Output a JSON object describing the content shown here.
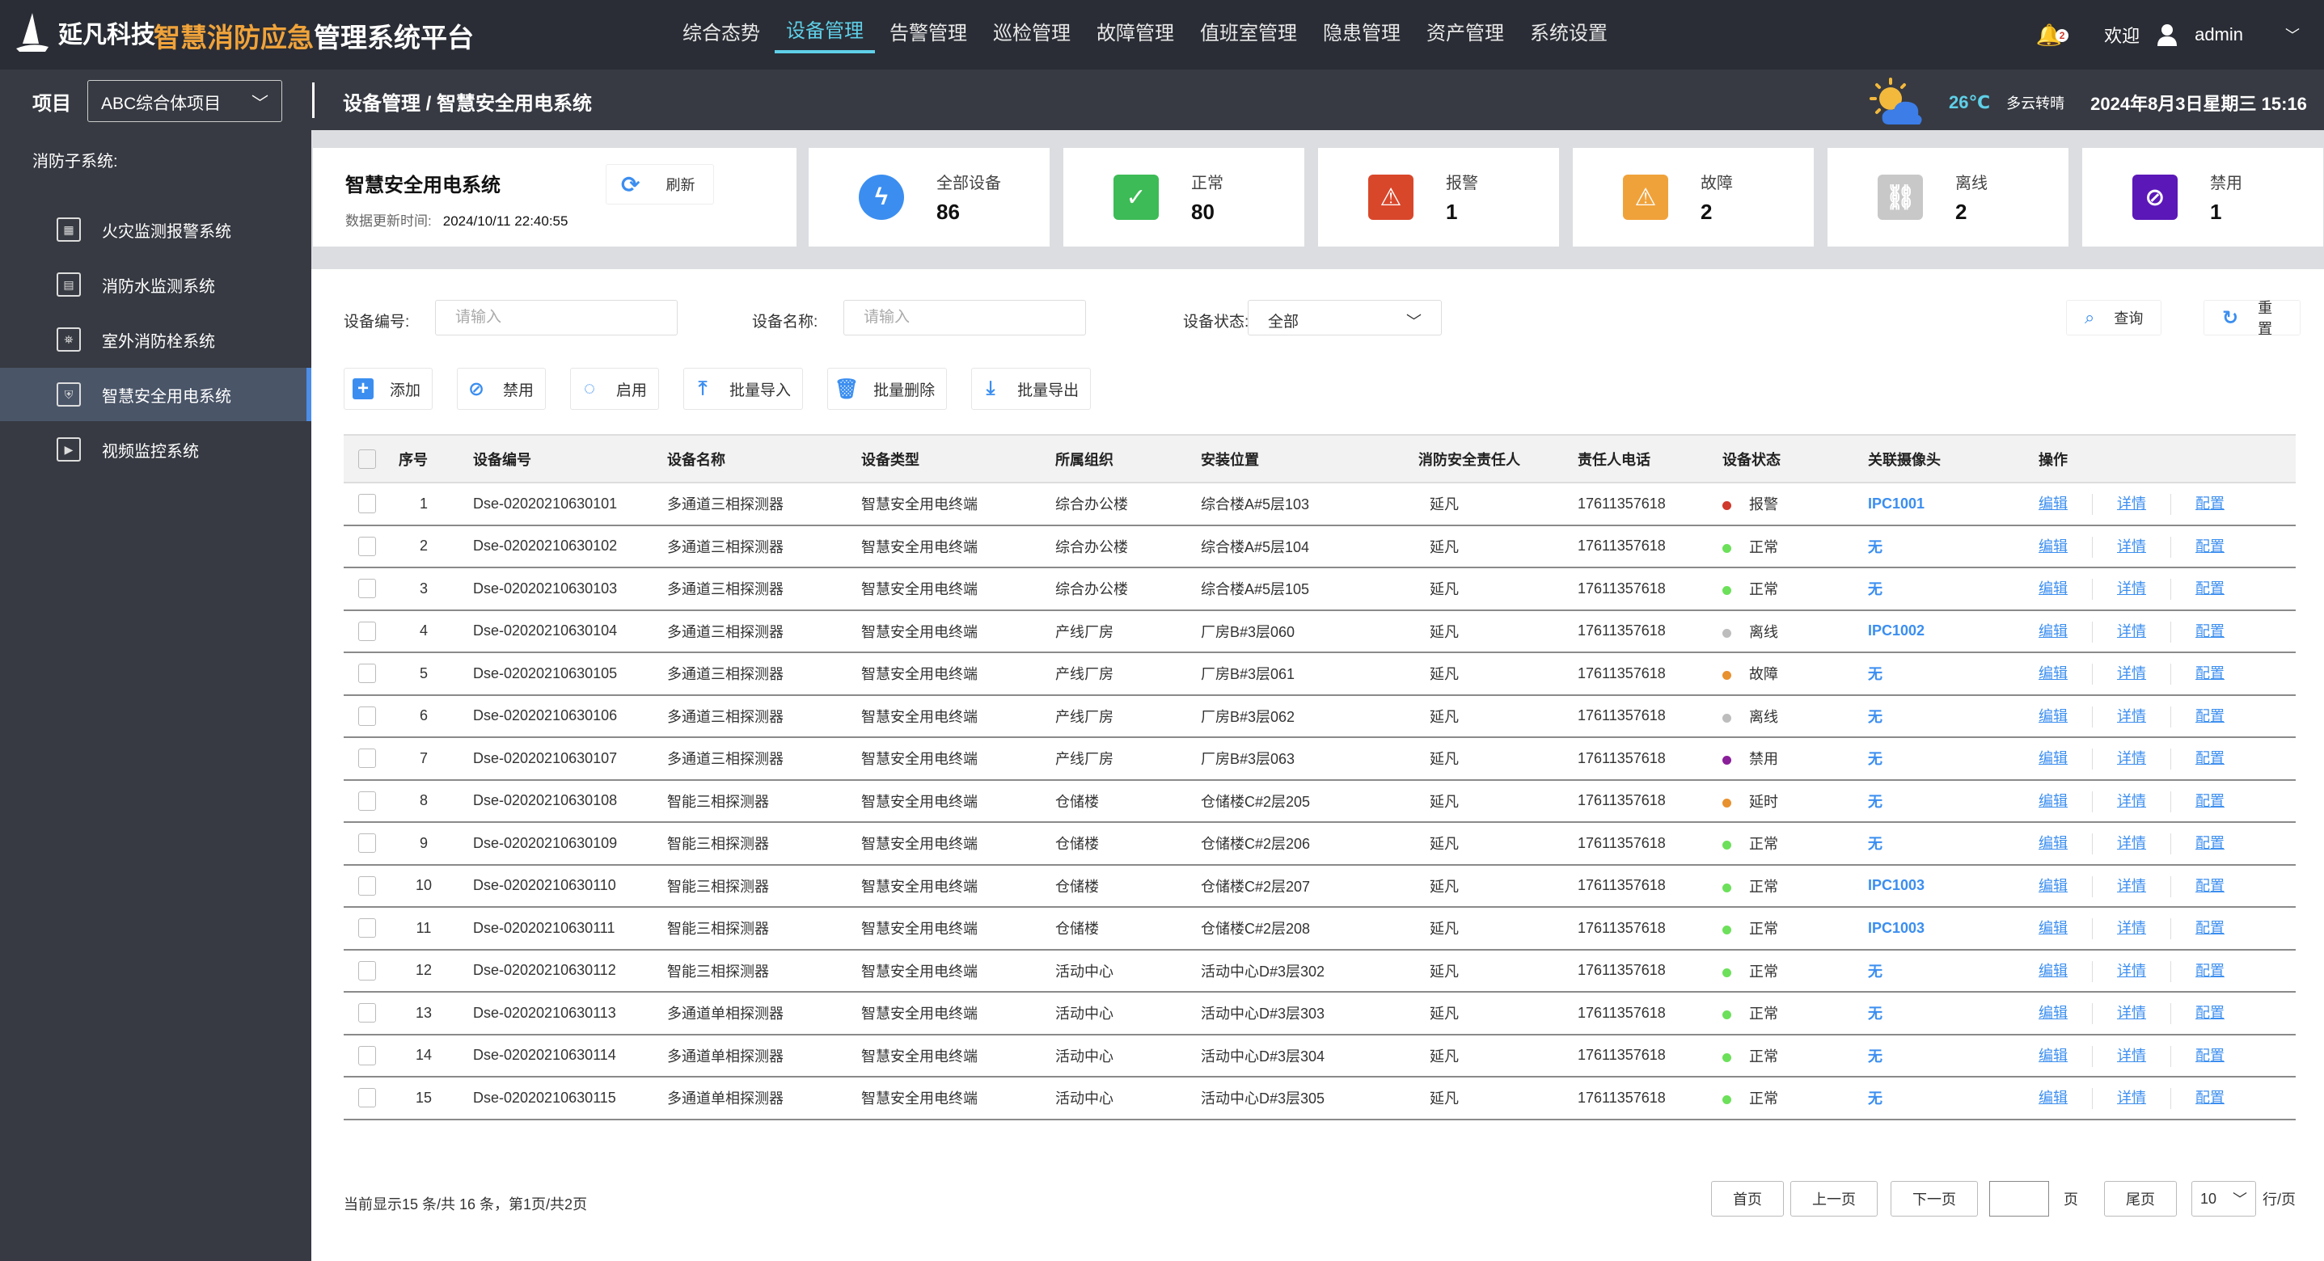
{
  "header": {
    "logo": "延凡科技",
    "title_highlight": "智慧消防应急",
    "title_rest": "管理系统平台",
    "nav": [
      "综合态势",
      "设备管理",
      "告警管理",
      "巡检管理",
      "故障管理",
      "值班室管理",
      "隐患管理",
      "资产管理",
      "系统设置"
    ],
    "active_nav": 1,
    "bell_count": "2",
    "welcome": "欢迎",
    "user": "admin"
  },
  "subbar": {
    "project_label": "项目",
    "project_value": "ABC综合体项目",
    "breadcrumb": "设备管理 / 智慧安全用电系统",
    "temperature": "26℃",
    "weather": "多云转晴",
    "datetime": "2024年8月3日星期三 15:16"
  },
  "sidebar": {
    "title": "消防子系统:",
    "items": [
      "火灾监测报警系统",
      "消防水监测系统",
      "室外消防栓系统",
      "智慧安全用电系统",
      "视频监控系统"
    ],
    "active": 3
  },
  "info": {
    "title": "智慧安全用电系统",
    "refresh": "刷新",
    "time_label": "数据更新时间:",
    "time_value": "2024/10/11 22:40:55"
  },
  "stats": [
    {
      "label": "全部设备",
      "value": "86",
      "color": "#3b8ef0",
      "icon": "lightning-icon"
    },
    {
      "label": "正常",
      "value": "80",
      "color": "#3dbb56",
      "icon": "check-icon"
    },
    {
      "label": "报警",
      "value": "1",
      "color": "#d9472b",
      "icon": "alarm-icon"
    },
    {
      "label": "故障",
      "value": "2",
      "color": "#f0a23a",
      "icon": "warning-icon"
    },
    {
      "label": "离线",
      "value": "2",
      "color": "#c8c8c8",
      "icon": "broken-link-icon"
    },
    {
      "label": "禁用",
      "value": "1",
      "color": "#5b17b8",
      "icon": "ban-icon"
    }
  ],
  "filters": {
    "code_label": "设备编号:",
    "code_placeholder": "请输入",
    "name_label": "设备名称:",
    "name_placeholder": "请输入",
    "status_label": "设备状态:",
    "status_value": "全部",
    "query": "查询",
    "reset": "重置"
  },
  "actions": [
    "添加",
    "禁用",
    "启用",
    "批量导入",
    "批量删除",
    "批量导出"
  ],
  "table": {
    "columns": [
      "序号",
      "设备编号",
      "设备名称",
      "设备类型",
      "所属组织",
      "安装位置",
      "消防安全责任人",
      "责任人电话",
      "设备状态",
      "关联摄像头",
      "操作"
    ],
    "ops": [
      "编辑",
      "详情",
      "配置"
    ],
    "rows": [
      [
        "1",
        "Dse-02020210630101",
        "多通道三相探测器",
        "智慧安全用电终端",
        "综合办公楼",
        "综合楼A#5层103",
        "延凡",
        "17611357618",
        "报警",
        "IPC1001"
      ],
      [
        "2",
        "Dse-02020210630102",
        "多通道三相探测器",
        "智慧安全用电终端",
        "综合办公楼",
        "综合楼A#5层104",
        "延凡",
        "17611357618",
        "正常",
        "无"
      ],
      [
        "3",
        "Dse-02020210630103",
        "多通道三相探测器",
        "智慧安全用电终端",
        "综合办公楼",
        "综合楼A#5层105",
        "延凡",
        "17611357618",
        "正常",
        "无"
      ],
      [
        "4",
        "Dse-02020210630104",
        "多通道三相探测器",
        "智慧安全用电终端",
        "产线厂房",
        "厂房B#3层060",
        "延凡",
        "17611357618",
        "离线",
        "IPC1002"
      ],
      [
        "5",
        "Dse-02020210630105",
        "多通道三相探测器",
        "智慧安全用电终端",
        "产线厂房",
        "厂房B#3层061",
        "延凡",
        "17611357618",
        "故障",
        "无"
      ],
      [
        "6",
        "Dse-02020210630106",
        "多通道三相探测器",
        "智慧安全用电终端",
        "产线厂房",
        "厂房B#3层062",
        "延凡",
        "17611357618",
        "离线",
        "无"
      ],
      [
        "7",
        "Dse-02020210630107",
        "多通道三相探测器",
        "智慧安全用电终端",
        "产线厂房",
        "厂房B#3层063",
        "延凡",
        "17611357618",
        "禁用",
        "无"
      ],
      [
        "8",
        "Dse-02020210630108",
        "智能三相探测器",
        "智慧安全用电终端",
        "仓储楼",
        "仓储楼C#2层205",
        "延凡",
        "17611357618",
        "延时",
        "无"
      ],
      [
        "9",
        "Dse-02020210630109",
        "智能三相探测器",
        "智慧安全用电终端",
        "仓储楼",
        "仓储楼C#2层206",
        "延凡",
        "17611357618",
        "正常",
        "无"
      ],
      [
        "10",
        "Dse-02020210630110",
        "智能三相探测器",
        "智慧安全用电终端",
        "仓储楼",
        "仓储楼C#2层207",
        "延凡",
        "17611357618",
        "正常",
        "IPC1003"
      ],
      [
        "11",
        "Dse-02020210630111",
        "智能三相探测器",
        "智慧安全用电终端",
        "仓储楼",
        "仓储楼C#2层208",
        "延凡",
        "17611357618",
        "正常",
        "IPC1003"
      ],
      [
        "12",
        "Dse-02020210630112",
        "智能三相探测器",
        "智慧安全用电终端",
        "活动中心",
        "活动中心D#3层302",
        "延凡",
        "17611357618",
        "正常",
        "无"
      ],
      [
        "13",
        "Dse-02020210630113",
        "多通道单相探测器",
        "智慧安全用电终端",
        "活动中心",
        "活动中心D#3层303",
        "延凡",
        "17611357618",
        "正常",
        "无"
      ],
      [
        "14",
        "Dse-02020210630114",
        "多通道单相探测器",
        "智慧安全用电终端",
        "活动中心",
        "活动中心D#3层304",
        "延凡",
        "17611357618",
        "正常",
        "无"
      ],
      [
        "15",
        "Dse-02020210630115",
        "多通道单相探测器",
        "智慧安全用电终端",
        "活动中心",
        "活动中心D#3层305",
        "延凡",
        "17611357618",
        "正常",
        "无"
      ]
    ]
  },
  "status_colors": {
    "报警": "#d0392b",
    "正常": "#6ce05a",
    "离线": "#bdbdbd",
    "故障": "#e8912f",
    "禁用": "#8a1f9a",
    "延时": "#e8912f"
  },
  "footer": {
    "summary": "当前显示15 条/共 16 条，第1页/共2页",
    "first": "首页",
    "prev": "上一页",
    "next": "下一页",
    "page_unit": "页",
    "last": "尾页",
    "page_size": "10",
    "per_page": "行/页"
  }
}
